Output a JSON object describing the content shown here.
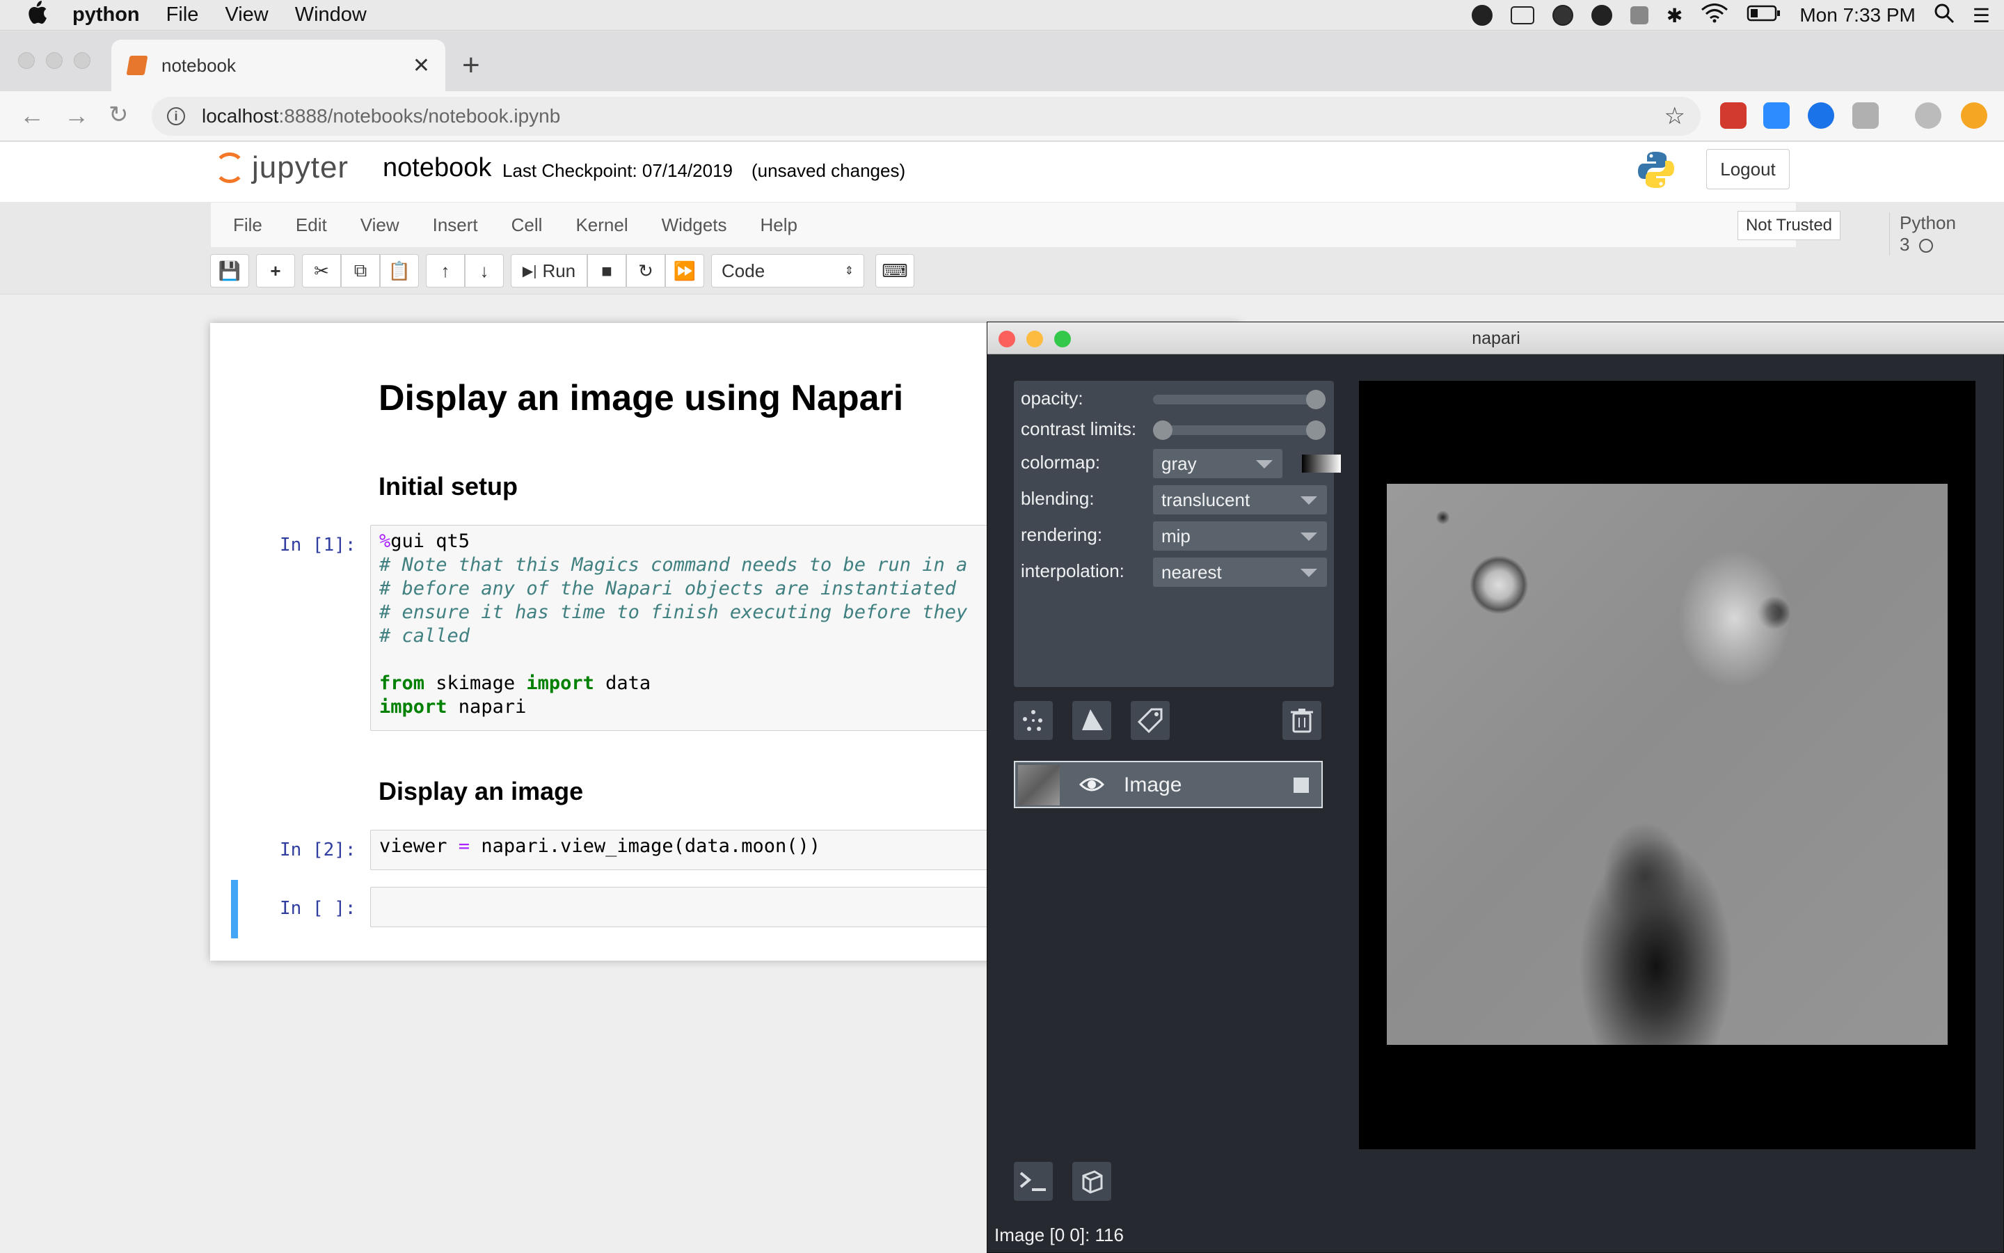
{
  "menubar": {
    "app_name": "python",
    "items": [
      "File",
      "View",
      "Window"
    ],
    "clock": "Mon 7:33 PM"
  },
  "browser": {
    "tab_title": "notebook",
    "url_host": "localhost",
    "url_path": ":8888/notebooks/notebook.ipynb"
  },
  "jupyter": {
    "logo_text": "jupyter",
    "notebook_name": "notebook",
    "checkpoint": "Last Checkpoint: 07/14/2019",
    "unsaved": "(unsaved changes)",
    "logout_label": "Logout",
    "menu": [
      "File",
      "Edit",
      "View",
      "Insert",
      "Cell",
      "Kernel",
      "Widgets",
      "Help"
    ],
    "trusted_label": "Not Trusted",
    "kernel_name": "Python 3",
    "run_label": "Run",
    "cell_type": "Code"
  },
  "notebook": {
    "heading": "Display an image using Napari",
    "section1": "Initial setup",
    "section2": "Display an image",
    "prompt1": "In [1]:",
    "prompt2": "In [2]:",
    "prompt3": "In [ ]:",
    "cell1": {
      "magic_prefix": "%",
      "magic_rest": "gui qt5",
      "comments": [
        "# Note that this Magics command needs to be run in a",
        "# before any of the Napari objects are instantiated",
        "# ensure it has time to finish executing before they",
        "# called"
      ],
      "line_from": [
        "from",
        " skimage ",
        "import",
        " data"
      ],
      "line_import": [
        "import",
        " napari"
      ]
    },
    "cell2": [
      "viewer ",
      "=",
      " napari.view_image(data.moon())"
    ]
  },
  "napari": {
    "title": "napari",
    "controls": {
      "opacity_label": "opacity:",
      "opacity_value": 1.0,
      "contrast_label": "contrast limits:",
      "colormap_label": "colormap:",
      "colormap_value": "gray",
      "blending_label": "blending:",
      "blending_value": "translucent",
      "rendering_label": "rendering:",
      "rendering_value": "mip",
      "interpolation_label": "interpolation:",
      "interpolation_value": "nearest"
    },
    "layer_name": "Image",
    "status": "Image [0 0]: 116"
  }
}
